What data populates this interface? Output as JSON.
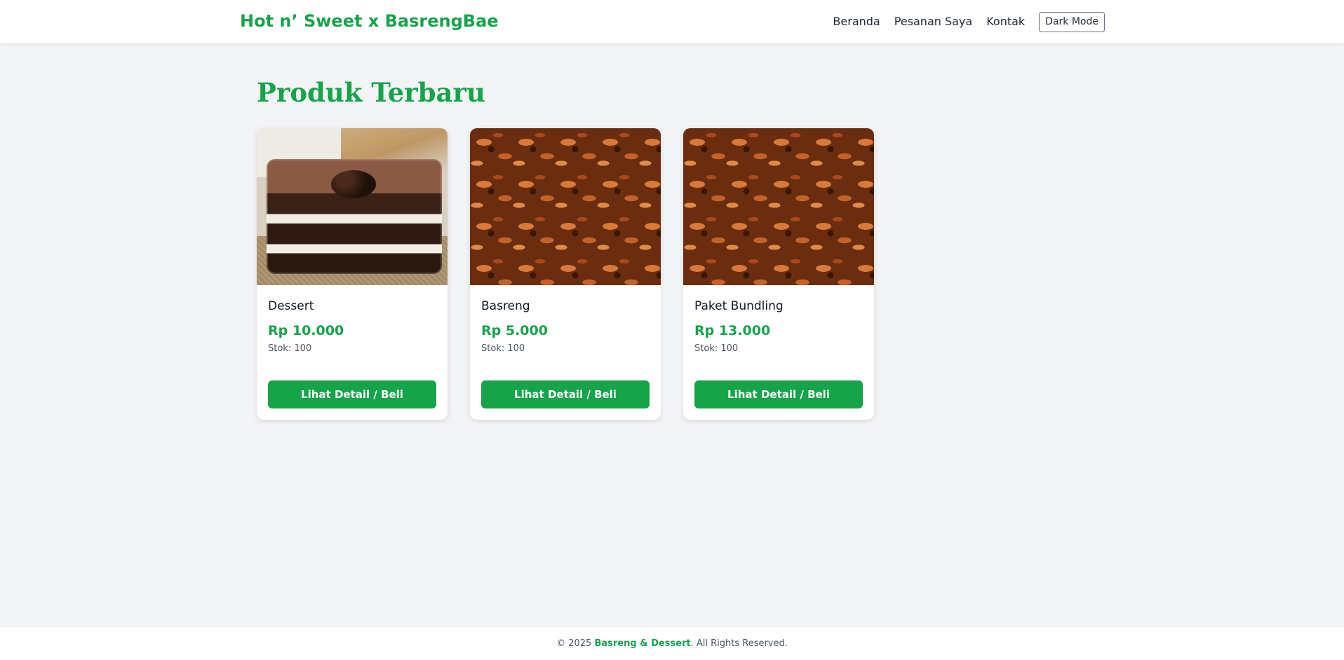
{
  "header": {
    "brand": "Hot n’ Sweet x BasrengBae",
    "nav": [
      {
        "label": "Beranda"
      },
      {
        "label": "Pesanan Saya"
      },
      {
        "label": "Kontak"
      }
    ],
    "dark_mode_label": "Dark Mode"
  },
  "main": {
    "title": "Produk Terbaru",
    "products": [
      {
        "name": "Dessert",
        "price": "Rp 10.000",
        "stock": "Stok: 100",
        "button": "Lihat Detail / Beli",
        "image": "chocolate-dessert-box"
      },
      {
        "name": "Basreng",
        "price": "Rp 5.000",
        "stock": "Stok: 100",
        "button": "Lihat Detail / Beli",
        "image": "spicy-basreng-chips"
      },
      {
        "name": "Paket Bundling",
        "price": "Rp 13.000",
        "stock": "Stok: 100",
        "button": "Lihat Detail / Beli",
        "image": "spicy-basreng-chips"
      }
    ]
  },
  "footer": {
    "prefix": "© 2025",
    "brand": "Basreng & Dessert",
    "suffix": ". All Rights Reserved."
  },
  "colors": {
    "accent": "#16a34a",
    "background": "#f3f4f6",
    "card": "#ffffff"
  }
}
